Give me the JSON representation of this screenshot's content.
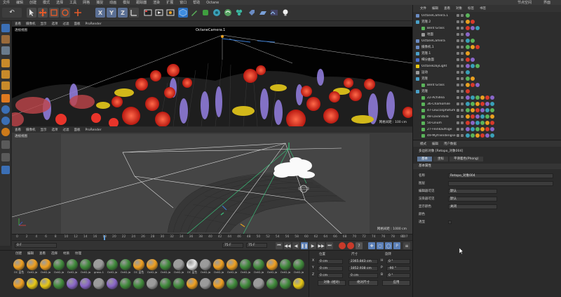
{
  "menubar": {
    "items": [
      "文件",
      "编辑",
      "创建",
      "模式",
      "选择",
      "工具",
      "网格",
      "捕捉",
      "动画",
      "模拟",
      "跟踪器",
      "渲染",
      "扩展",
      "窗口",
      "帮助",
      "Octane"
    ],
    "right": [
      "节点空间",
      "界面"
    ]
  },
  "toolbar": {
    "axis_labels": [
      "X",
      "Y",
      "Z"
    ]
  },
  "viewport_top": {
    "menu": [
      "查看",
      "摄像机",
      "显示",
      "选项",
      "过滤",
      "面板",
      "ProRender"
    ],
    "label": "透视视图",
    "camera_tag": "OctaneCamera.1",
    "grid_info": "网格间距 : 100 cm"
  },
  "viewport_bottom": {
    "menu": [
      "查看",
      "摄像机",
      "显示",
      "选项",
      "过滤",
      "面板",
      "ProRender"
    ],
    "label": "透视视图",
    "grid_info": "网格间距 : 1000 cm"
  },
  "timeline": {
    "ticks": [
      "0",
      "2",
      "4",
      "6",
      "8",
      "10",
      "12",
      "14",
      "16",
      "18",
      "20",
      "22",
      "24",
      "26",
      "28",
      "30",
      "32",
      "34",
      "36",
      "38",
      "40",
      "42",
      "44",
      "46",
      "48",
      "50",
      "52",
      "54",
      "56",
      "58",
      "60",
      "62",
      "64",
      "66",
      "68",
      "70",
      "72",
      "74",
      "76",
      "78",
      "80"
    ],
    "end_frame": "107"
  },
  "transport": {
    "start": "0 F",
    "current": "0 F",
    "end": "75 F",
    "end2": "75 F"
  },
  "material_manager": {
    "menu": [
      "创建",
      "编辑",
      "查看",
      "选择",
      "材质",
      "纹理"
    ],
    "row1": [
      "OC 蓝色",
      "OctG-ja",
      "OctG-ja",
      "OctG-ja",
      "OctG-ja",
      "OctG-ja",
      "grass-1",
      "OctG-ja",
      "OctG-ja",
      "OC 蓝色",
      "OctG-ja",
      "OctG-ja",
      "OctG-ja",
      "OC 蓝色",
      "OctG-ja",
      "OctG-ja",
      "OctG-ja",
      "OctG-ja",
      "OctG-ja",
      "OctG-ja",
      "OctG-ja",
      "OctG-ja"
    ],
    "row2": [
      "",
      "",
      "",
      "",
      "",
      "",
      "",
      "",
      "",
      "",
      "",
      "",
      "",
      "",
      "",
      "",
      "",
      "",
      "",
      "",
      "",
      ""
    ],
    "colors": {
      "orange": "#f0a020",
      "green": "#3f8a3a",
      "purple": "#8a66c8",
      "white": "#e6e6e6",
      "gray": "#9a9a9a",
      "yellow": "#e8c814",
      "red": "#d83a2a"
    }
  },
  "coordinates": {
    "headers": [
      "位置",
      "尺寸",
      "旋转"
    ],
    "rows": [
      {
        "axis": "X",
        "pos": "0 cm",
        "size": "2365.843 cm",
        "rot_axis": "H",
        "rot": "0 °"
      },
      {
        "axis": "Y",
        "pos": "0 cm",
        "size": "1852.938 cm",
        "rot_axis": "P",
        "rot": "-90 °"
      },
      {
        "axis": "Z",
        "pos": "0 cm",
        "size": "0 cm",
        "rot_axis": "B",
        "rot": "0 °"
      }
    ],
    "mode_select": "对象 (相对)",
    "size_select": "绝对尺寸",
    "apply_button": "应用"
  },
  "object_manager": {
    "menu": [
      "文件",
      "编辑",
      "查看",
      "对象",
      "标签",
      "书签"
    ],
    "objects": [
      {
        "name": "OctaneCamera.1",
        "color": "#6a8bc2",
        "indent": 0,
        "selected": false
      },
      {
        "name": "克隆.2",
        "color": "#4aa0c8",
        "indent": 0,
        "selected": false
      },
      {
        "name": "Bent Grass",
        "color": "#5ab45a",
        "indent": 8,
        "selected": false
      },
      {
        "name": "地面",
        "color": "#9a9a9a",
        "indent": 8,
        "selected": false
      },
      {
        "name": "OctaneCamera",
        "color": "#6a8bc2",
        "indent": 0,
        "selected": false
      },
      {
        "name": "摄像机.1",
        "color": "#6a8bc2",
        "indent": 0,
        "selected": false
      },
      {
        "name": "克隆.1",
        "color": "#4aa0c8",
        "indent": 0,
        "selected": false
      },
      {
        "name": "细分曲面",
        "color": "#4a6fd0",
        "indent": 0,
        "selected": false
      },
      {
        "name": "OctaneDayLight",
        "color": "#e8c814",
        "indent": 0,
        "selected": false
      },
      {
        "name": "运动",
        "color": "#9a9a9a",
        "indent": 0,
        "selected": false
      },
      {
        "name": "克隆",
        "color": "#4aa0c8",
        "indent": 0,
        "selected": false
      },
      {
        "name": "Bent Grass",
        "color": "#5ab45a",
        "indent": 8,
        "selected": false
      },
      {
        "name": "克隆",
        "color": "#4aa0c8",
        "indent": 0,
        "selected": false
      },
      {
        "name": "22-Achillea",
        "color": "#5ab45a",
        "indent": 8,
        "selected": false
      },
      {
        "name": "36-Chamomile",
        "color": "#5ab45a",
        "indent": 8,
        "selected": false
      },
      {
        "name": "47-Leucosphotum",
        "color": "#5ab45a",
        "indent": 8,
        "selected": false
      },
      {
        "name": "48-Lavandula",
        "color": "#5ab45a",
        "indent": 8,
        "selected": false
      },
      {
        "name": "50-Lilium",
        "color": "#5ab45a",
        "indent": 8,
        "selected": false
      },
      {
        "name": "27-Feinkaufsige",
        "color": "#5ab45a",
        "indent": 8,
        "selected": false
      },
      {
        "name": "49-Myfriendengse",
        "color": "#5ab45a",
        "indent": 8,
        "selected": false
      }
    ]
  },
  "attributes": {
    "menu": [
      "模式",
      "编辑",
      "用户数据"
    ],
    "object_title": "多边形对象 [Retopo_对象004]",
    "tabs": [
      "基本",
      "坐标",
      "平滑着色(Phong)"
    ],
    "section": "基本属性",
    "fields": [
      {
        "key": "名称",
        "value": "Retopo_对象004"
      },
      {
        "key": "图层",
        "value": ""
      },
      {
        "key": "编辑器可见",
        "value": "默认"
      },
      {
        "key": "渲染器可见",
        "value": "默认"
      },
      {
        "key": "显示颜色",
        "value": "关闭"
      },
      {
        "key": "颜色",
        "value": ""
      },
      {
        "key": "透显",
        "value": ""
      }
    ]
  }
}
